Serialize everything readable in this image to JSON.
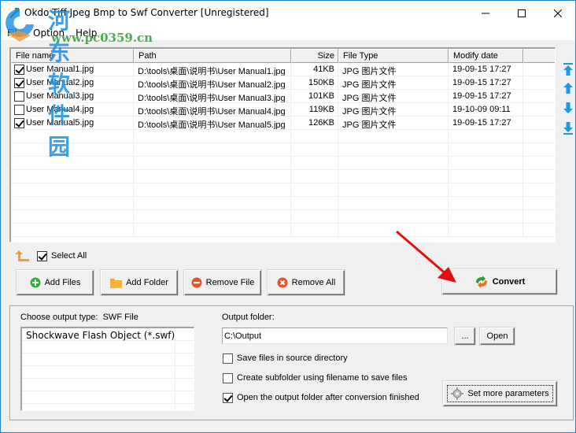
{
  "window": {
    "title": "Okdo Tiff Jpeg Bmp to Swf Converter [Unregistered]",
    "controls": {
      "minimize": "minimize",
      "maximize": "maximize",
      "close": "close"
    }
  },
  "watermark": {
    "chinese": "河东软件园",
    "url": "www.pc0359.cn"
  },
  "menu": {
    "items": [
      "File",
      "Option",
      "Help"
    ]
  },
  "file_list": {
    "columns": [
      "File name",
      "Path",
      "Size",
      "File Type",
      "Modify date",
      ""
    ],
    "rows": [
      {
        "checked": true,
        "name": "User Manual1.jpg",
        "path": "D:\\tools\\桌面\\说明书\\User Manual1.jpg",
        "size": "41KB",
        "type": "JPG 图片文件",
        "date": "19-09-15 17:27"
      },
      {
        "checked": true,
        "name": "User Manual2.jpg",
        "path": "D:\\tools\\桌面\\说明书\\User Manual2.jpg",
        "size": "150KB",
        "type": "JPG 图片文件",
        "date": "19-09-15 17:27"
      },
      {
        "checked": false,
        "name": "User Manual3.jpg",
        "path": "D:\\tools\\桌面\\说明书\\User Manual3.jpg",
        "size": "101KB",
        "type": "JPG 图片文件",
        "date": "19-09-15 17:27"
      },
      {
        "checked": false,
        "name": "User Manual4.jpg",
        "path": "D:\\tools\\桌面\\说明书\\User Manual4.jpg",
        "size": "119KB",
        "type": "JPG 图片文件",
        "date": "19-10-09 09:11"
      },
      {
        "checked": true,
        "name": "User Manual5.jpg",
        "path": "D:\\tools\\桌面\\说明书\\User Manual5.jpg",
        "size": "126KB",
        "type": "JPG 图片文件",
        "date": "19-09-15 17:27"
      }
    ],
    "empty_rows": 8
  },
  "side_arrows": [
    "move-top",
    "move-up",
    "move-down",
    "move-bottom"
  ],
  "select_all": {
    "label": "Select All",
    "checked": true
  },
  "buttons": {
    "add_files": "Add Files",
    "add_folder": "Add Folder",
    "remove_file": "Remove File",
    "remove_all": "Remove All",
    "convert": "Convert",
    "browse": "...",
    "open": "Open",
    "set_params": "Set more parameters"
  },
  "output": {
    "type_label": "Choose output type:",
    "type_value": "SWF File",
    "types": [
      "Shockwave Flash Object (*.swf)"
    ],
    "folder_label": "Output folder:",
    "folder_value": "C:\\Output",
    "options": [
      {
        "label": "Save files in source directory",
        "checked": false
      },
      {
        "label": "Create subfolder using filename to save files",
        "checked": false
      },
      {
        "label": "Open the output folder after conversion finished",
        "checked": true
      }
    ]
  },
  "colors": {
    "accent": "#1883d7",
    "arrow_blue": "#1a9be8",
    "annotation_red": "#e01010"
  }
}
